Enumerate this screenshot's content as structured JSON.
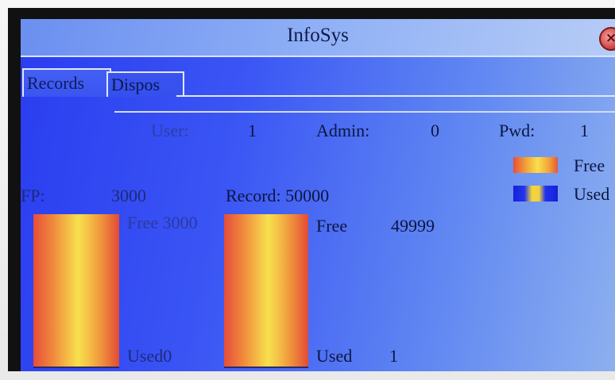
{
  "window": {
    "title": "InfoSys"
  },
  "tabs": [
    {
      "label": "Records",
      "active": true
    },
    {
      "label": "Dispos",
      "active": false
    }
  ],
  "counts": {
    "user_label": "User:",
    "user_value": "1",
    "admin_label": "Admin:",
    "admin_value": "0",
    "pwd_label": "Pwd:",
    "pwd_value": "1"
  },
  "legend": {
    "free_label": "Free",
    "used_label": "Used"
  },
  "fp": {
    "label": "FP:",
    "capacity": "3000",
    "free_text": "Free 3000",
    "used_text": "Used0",
    "free_fraction": 1.0
  },
  "record": {
    "label": "Record: 50000",
    "free_label": "Free",
    "free_value": "49999",
    "used_label": "Used",
    "used_value": "1",
    "free_fraction": 0.99998
  },
  "colors": {
    "screen_blue": "#3a55f4",
    "free_orange": "#f0873c",
    "free_yellow": "#f7e04c",
    "used_blue": "#2433ef",
    "close_red": "#d24a4a"
  }
}
